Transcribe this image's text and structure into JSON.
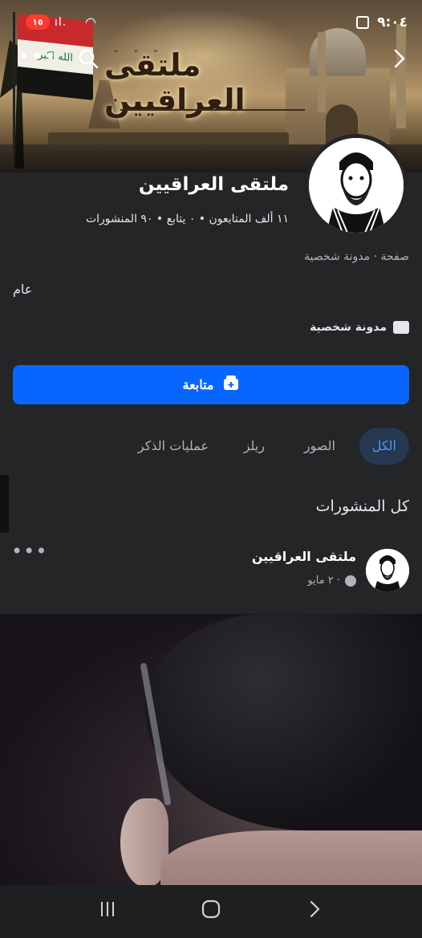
{
  "status_bar": {
    "time": "٩:٠٤",
    "battery": "١٥"
  },
  "cover": {
    "title": "ملتقى العراقيين",
    "flag_text": "الله اكبر"
  },
  "profile": {
    "page_name": "ملتقى العراقيين",
    "stats": "١١ ألف المتابعون • ٠ يتابع • ٩٠ المنشورات",
    "category": "صفحة · مدونة شخصية",
    "about": "عام",
    "detail_label": "مدونة شخصية",
    "follow_label": "متابعة"
  },
  "tabs": [
    {
      "label": "الكل",
      "active": true
    },
    {
      "label": "الصور",
      "active": false
    },
    {
      "label": "ريلز",
      "active": false
    },
    {
      "label": "عمليات الذكر",
      "active": false
    }
  ],
  "section_title": "كل المنشورات",
  "post": {
    "author": "ملتقى العراقيين",
    "meta": "٢ مايو ·"
  },
  "colors": {
    "background": "#242526",
    "accent": "#0866ff",
    "tab_active_bg": "#263951",
    "tab_active_text": "#4599ff"
  },
  "icons": [
    "back-icon",
    "search-icon",
    "more-icon",
    "blog-icon",
    "follow-add-icon",
    "globe-icon",
    "recent-apps-icon",
    "home-icon",
    "back-nav-icon"
  ]
}
